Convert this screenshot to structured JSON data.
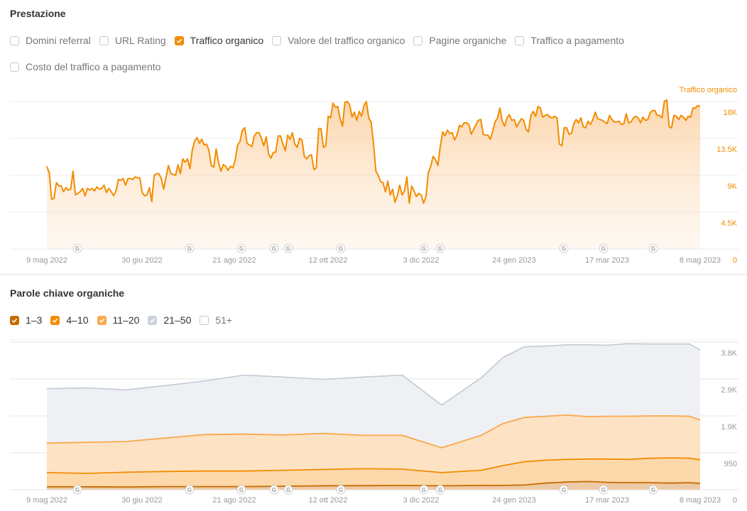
{
  "performance": {
    "title": "Prestazione",
    "metrics": [
      {
        "label": "Domini referral",
        "checked": false
      },
      {
        "label": "URL Rating",
        "checked": false
      },
      {
        "label": "Traffico organico",
        "checked": true
      },
      {
        "label": "Valore del traffico organico",
        "checked": false
      },
      {
        "label": "Pagine organiche",
        "checked": false
      },
      {
        "label": "Traffico a pagamento",
        "checked": false
      },
      {
        "label": "Costo del traffico a pagamento",
        "checked": false
      }
    ]
  },
  "keywords": {
    "title": "Parole chiave organiche",
    "ranges": [
      {
        "label": "1–3",
        "checked": true,
        "color": "#c96a00"
      },
      {
        "label": "4–10",
        "checked": true,
        "color": "#f28c00"
      },
      {
        "label": "11–20",
        "checked": true,
        "color": "#f9a84d"
      },
      {
        "label": "21–50",
        "checked": true,
        "color": "#c9cfd8"
      },
      {
        "label": "51+",
        "checked": false,
        "color": "#ffffff"
      }
    ]
  },
  "colors": {
    "accent": "#f28c00",
    "grid": "#ebebeb",
    "gray_series": "#c2cad4",
    "gray_fill": "#eef0f4"
  },
  "chart_data": [
    {
      "type": "area",
      "title": "Traffico organico",
      "series_name": "Traffico organico",
      "x_tick_labels": [
        "9 mag 2022",
        "30 giu 2022",
        "21 ago 2022",
        "12 ott 2022",
        "3 dic 2022",
        "24 gen 2023",
        "17 mar 2023",
        "8 mag 2023"
      ],
      "y_tick_labels": [
        "0",
        "4.5K",
        "9K",
        "13.5K",
        "18K"
      ],
      "y_ticks": [
        0,
        4500,
        9000,
        13500,
        18000
      ],
      "ylim": [
        0,
        18000
      ],
      "x_range_days": [
        0,
        364
      ],
      "grid": true,
      "legend": "top-right",
      "google_update_markers_days": [
        24,
        95,
        126,
        145,
        152,
        205,
        310,
        319,
        377,
        397,
        417
      ],
      "values": [
        10100,
        9300,
        6100,
        6200,
        8100,
        7700,
        7700,
        7000,
        7500,
        7200,
        7300,
        9500,
        6600,
        6800,
        7000,
        7400,
        6500,
        7400,
        7200,
        7400,
        7100,
        7600,
        7300,
        7400,
        7800,
        6900,
        7400,
        7000,
        6500,
        7100,
        8500,
        8400,
        8600,
        7800,
        8600,
        8600,
        8500,
        8800,
        8700,
        8700,
        6900,
        6500,
        6600,
        7500,
        5800,
        9000,
        9200,
        9200,
        8600,
        7300,
        8800,
        10200,
        9200,
        9100,
        9000,
        10300,
        9200,
        11000,
        10600,
        11000,
        9800,
        12100,
        13200,
        13600,
        12900,
        13400,
        12700,
        12800,
        12000,
        10200,
        10000,
        12200,
        10500,
        9500,
        10300,
        10100,
        9600,
        10100,
        9900,
        10900,
        12700,
        13100,
        14500,
        14800,
        12900,
        12700,
        12500,
        13800,
        14200,
        14200,
        13500,
        12600,
        13700,
        11600,
        11100,
        11800,
        11800,
        13800,
        13800,
        12800,
        12000,
        13900,
        13400,
        14200,
        12800,
        12400,
        13500,
        13300,
        11300,
        11000,
        11400,
        11500,
        9700,
        9900,
        14700,
        14700,
        12400,
        12600,
        16200,
        16000,
        17800,
        17300,
        17400,
        15900,
        15000,
        17900,
        18000,
        17600,
        16100,
        16700,
        15700,
        16800,
        16200,
        17500,
        18000,
        16000,
        15500,
        12900,
        9500,
        9000,
        8200,
        8100,
        7000,
        8300,
        6600,
        7300,
        5700,
        6500,
        7800,
        6600,
        7100,
        8800,
        5600,
        7700,
        7100,
        6400,
        6800,
        6600,
        5600,
        6400,
        9300,
        10100,
        11300,
        10900,
        10200,
        12500,
        14300,
        13800,
        14500,
        14100,
        14200,
        13300,
        13900,
        15100,
        14900,
        15400,
        15400,
        15200,
        14000,
        14600,
        15200,
        15700,
        15800,
        14000,
        13900,
        13900,
        13400,
        14400,
        15500,
        16000,
        17200,
        15600,
        15000,
        16000,
        16400,
        15700,
        15800,
        14900,
        15400,
        15900,
        15700,
        14600,
        14300,
        16300,
        16800,
        16200,
        17400,
        17200,
        16100,
        16300,
        16400,
        16100,
        16000,
        16200,
        16000,
        12800,
        12600,
        14800,
        14800,
        14000,
        14100,
        15300,
        15800,
        15400,
        16000,
        14900,
        14800,
        15600,
        15200,
        15800,
        16700,
        15900,
        15800,
        15700,
        15500,
        15300,
        16300,
        15800,
        15500,
        15500,
        15600,
        15200,
        15300,
        16500,
        15400,
        15500,
        16000,
        16200,
        16000,
        15400,
        16100,
        15700,
        15800,
        16600,
        16900,
        16900,
        16300,
        16300,
        16000,
        18000,
        18200,
        14900,
        14800,
        16300,
        16200,
        15800,
        16300,
        16100,
        15700,
        16200,
        16100,
        17200,
        17200,
        17500,
        17400
      ]
    },
    {
      "type": "area",
      "title": "Parole chiave organiche",
      "stacked": true,
      "x_tick_labels": [
        "9 mag 2022",
        "30 giu 2022",
        "21 ago 2022",
        "12 ott 2022",
        "3 dic 2022",
        "24 gen 2023",
        "17 mar 2023",
        "8 mag 2023"
      ],
      "y_tick_labels": [
        "0",
        "950",
        "1.9K",
        "2.9K",
        "3.8K"
      ],
      "y_ticks": [
        0,
        950,
        1900,
        2850,
        3800
      ],
      "ylim": [
        0,
        3800
      ],
      "grid": true,
      "x_points_days": [
        0,
        22,
        44,
        66,
        88,
        110,
        132,
        154,
        176,
        198,
        220,
        242,
        254,
        266,
        278,
        290,
        302,
        312,
        324,
        336,
        348,
        358,
        364
      ],
      "series": [
        {
          "name": "1–3",
          "cumulative_top": [
            75,
            75,
            70,
            80,
            80,
            80,
            90,
            100,
            105,
            110,
            100,
            110,
            110,
            120,
            170,
            200,
            210,
            190,
            180,
            180,
            170,
            180,
            160
          ]
        },
        {
          "name": "4–10",
          "cumulative_top": [
            440,
            420,
            450,
            470,
            480,
            480,
            500,
            520,
            540,
            530,
            440,
            500,
            620,
            720,
            760,
            780,
            790,
            790,
            780,
            810,
            820,
            810,
            770
          ]
        },
        {
          "name": "11–20",
          "cumulative_top": [
            1200,
            1220,
            1240,
            1330,
            1420,
            1430,
            1410,
            1450,
            1400,
            1400,
            1080,
            1400,
            1700,
            1860,
            1890,
            1920,
            1880,
            1890,
            1890,
            1900,
            1900,
            1890,
            1800
          ]
        },
        {
          "name": "21–50",
          "cumulative_top": [
            2600,
            2620,
            2570,
            2680,
            2800,
            2950,
            2900,
            2840,
            2900,
            2950,
            2180,
            2880,
            3400,
            3680,
            3700,
            3730,
            3730,
            3720,
            3760,
            3750,
            3750,
            3750,
            3600
          ]
        }
      ]
    }
  ]
}
